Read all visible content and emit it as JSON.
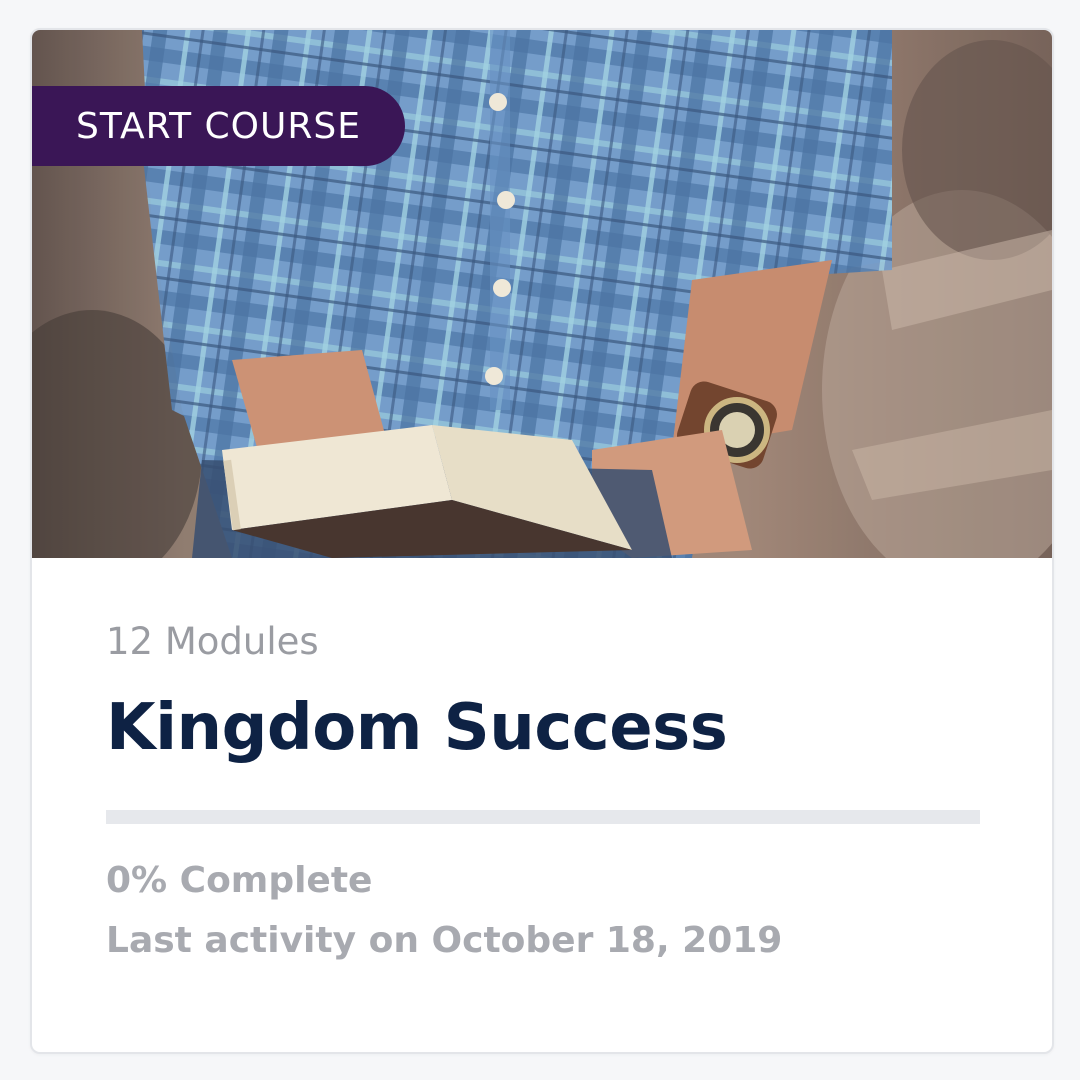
{
  "course": {
    "badge_label": "START COURSE",
    "modules_label": "12 Modules",
    "title": "Kingdom Success",
    "progress_percent": 0,
    "complete_label": "0% Complete",
    "last_activity": "Last activity on October 18, 2019"
  },
  "colors": {
    "badge_bg": "#3a1656",
    "title": "#0e2244",
    "muted": "#a8aab0",
    "progress_track": "#e6e8ec"
  },
  "hero_image": {
    "icon": "course-cover-photo"
  }
}
